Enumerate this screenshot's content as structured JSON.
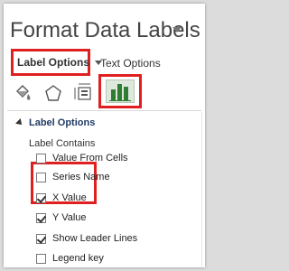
{
  "panel": {
    "title": "Format Data Labels"
  },
  "tabs": {
    "label_options": "Label Options",
    "text_options": "Text Options"
  },
  "section": {
    "title": "Label Options",
    "subhead": "Label Contains"
  },
  "options": [
    {
      "label": "Value From Cells",
      "checked": false
    },
    {
      "label": "Series Name",
      "checked": false
    },
    {
      "label": "X Value",
      "checked": true
    },
    {
      "label": "Y Value",
      "checked": true
    },
    {
      "label": "Show Leader Lines",
      "checked": true
    },
    {
      "label": "Legend key",
      "checked": false
    }
  ],
  "icons": {
    "fill": "fill-line-icon",
    "effects": "effects-pentagon-icon",
    "size": "size-properties-icon",
    "chart": "label-options-chart-icon"
  },
  "colors": {
    "highlight": "#e02020",
    "section_text": "#1f3b64",
    "chart_icon_bars": "#2e7d32"
  }
}
